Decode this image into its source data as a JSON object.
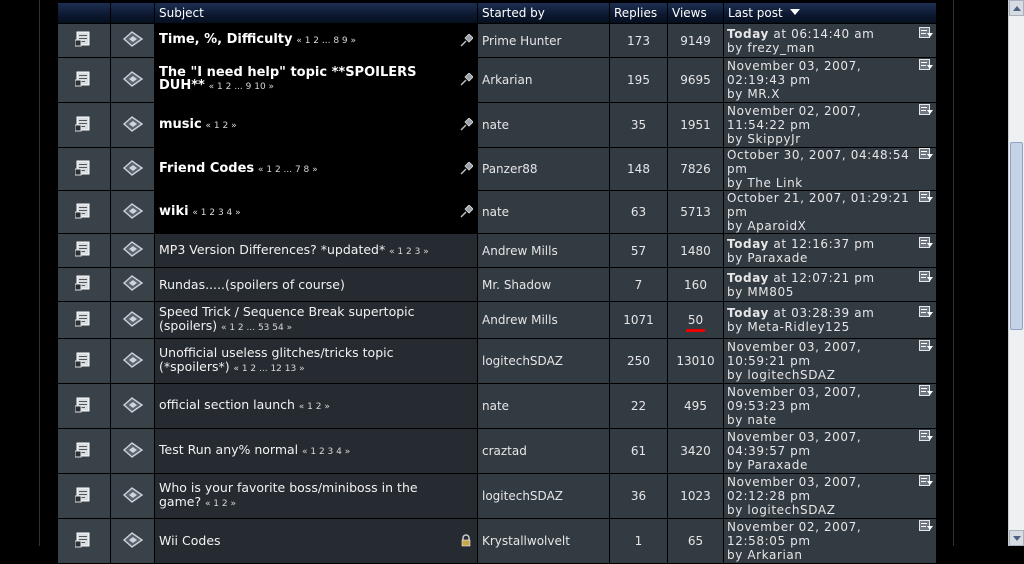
{
  "header": {
    "subject": "Subject",
    "started_by": "Started by",
    "replies": "Replies",
    "views": "Views",
    "last_post": "Last post",
    "sort_icon": "sort-desc-triangle-icon"
  },
  "icons": {
    "topic": "topic-document-icon",
    "post": "message-arrow-icon",
    "sticky": "pin-icon",
    "locked": "lock-icon",
    "goto": "goto-last-post-icon"
  },
  "colors": {
    "highlight": "#e00000",
    "header_bg": "#0c1830"
  },
  "topics": [
    {
      "subject": "Time, %, Difficulty",
      "pages": "« 1 2 ... 8 9 »",
      "started_by": "Prime Hunter",
      "replies": "173",
      "views": "9149",
      "last_date": "at 06:14:40 am",
      "today": "Today",
      "last_by": "by frezy_man",
      "sticky": true,
      "locked": false
    },
    {
      "subject": "The \"I need help\" topic **SPOILERS DUH**",
      "pages": "« 1 2 ... 9 10 »",
      "started_by": "Arkarian",
      "replies": "195",
      "views": "9695",
      "last_date": "November 03, 2007, 02:19:43 pm",
      "today": "",
      "last_by": "by MR.X",
      "sticky": true,
      "locked": false
    },
    {
      "subject": "music",
      "pages": "« 1 2 »",
      "started_by": "nate",
      "replies": "35",
      "views": "1951",
      "last_date": "November 02, 2007, 11:54:22 pm",
      "today": "",
      "last_by": "by SkippyJr",
      "sticky": true,
      "locked": false
    },
    {
      "subject": "Friend Codes",
      "pages": "« 1 2 ... 7 8 »",
      "started_by": "Panzer88",
      "replies": "148",
      "views": "7826",
      "last_date": "October 30, 2007, 04:48:54 pm",
      "today": "",
      "last_by": "by The Link",
      "sticky": true,
      "locked": false
    },
    {
      "subject": "wiki",
      "pages": "« 1 2 3 4 »",
      "started_by": "nate",
      "replies": "63",
      "views": "5713",
      "last_date": "October 21, 2007, 01:29:21 pm",
      "today": "",
      "last_by": "by AparoidX",
      "sticky": true,
      "locked": false
    },
    {
      "subject": "MP3 Version Differences? *updated*",
      "pages": "« 1 2 3 »",
      "started_by": "Andrew Mills",
      "replies": "57",
      "views": "1480",
      "last_date": "at 12:16:37 pm",
      "today": "Today",
      "last_by": "by Paraxade",
      "sticky": false,
      "locked": false
    },
    {
      "subject": "Rundas.....(spoilers of course)",
      "pages": "",
      "started_by": "Mr. Shadow",
      "replies": "7",
      "views": "160",
      "last_date": "at 12:07:21 pm",
      "today": "Today",
      "last_by": "by MM805",
      "sticky": false,
      "locked": false
    },
    {
      "subject": "Speed Trick / Sequence Break supertopic (spoilers)",
      "pages": "« 1 2 ... 53 54 »",
      "started_by": "Andrew Mills",
      "replies": "1071",
      "views": "50",
      "last_date": "at 03:28:39 am",
      "today": "Today",
      "last_by": "by Meta-Ridley125",
      "sticky": false,
      "locked": false,
      "highlight_views": true
    },
    {
      "subject": "Unofficial useless glitches/tricks topic (*spoilers*)",
      "pages": "« 1 2 ... 12 13 »",
      "started_by": "logitechSDAZ",
      "replies": "250",
      "views": "13010",
      "last_date": "November 03, 2007, 10:59:21 pm",
      "today": "",
      "last_by": "by logitechSDAZ",
      "sticky": false,
      "locked": false
    },
    {
      "subject": "official section launch",
      "pages": "« 1 2 »",
      "started_by": "nate",
      "replies": "22",
      "views": "495",
      "last_date": "November 03, 2007, 09:53:23 pm",
      "today": "",
      "last_by": "by nate",
      "sticky": false,
      "locked": false
    },
    {
      "subject": "Test Run any% normal",
      "pages": "« 1 2 3 4 »",
      "started_by": "craztad",
      "replies": "61",
      "views": "3420",
      "last_date": "November 03, 2007, 04:39:57 pm",
      "today": "",
      "last_by": "by Paraxade",
      "sticky": false,
      "locked": false
    },
    {
      "subject": "Who is your favorite boss/miniboss in the game?",
      "pages": "« 1 2 »",
      "started_by": "logitechSDAZ",
      "replies": "36",
      "views": "1023",
      "last_date": "November 03, 2007, 02:12:28 pm",
      "today": "",
      "last_by": "by logitechSDAZ",
      "sticky": false,
      "locked": false
    },
    {
      "subject": "Wii Codes",
      "pages": "",
      "started_by": "Krystallwolvelt",
      "replies": "1",
      "views": "65",
      "last_date": "November 02, 2007, 12:58:05 pm",
      "today": "",
      "last_by": "by Arkarian",
      "sticky": false,
      "locked": true
    }
  ]
}
